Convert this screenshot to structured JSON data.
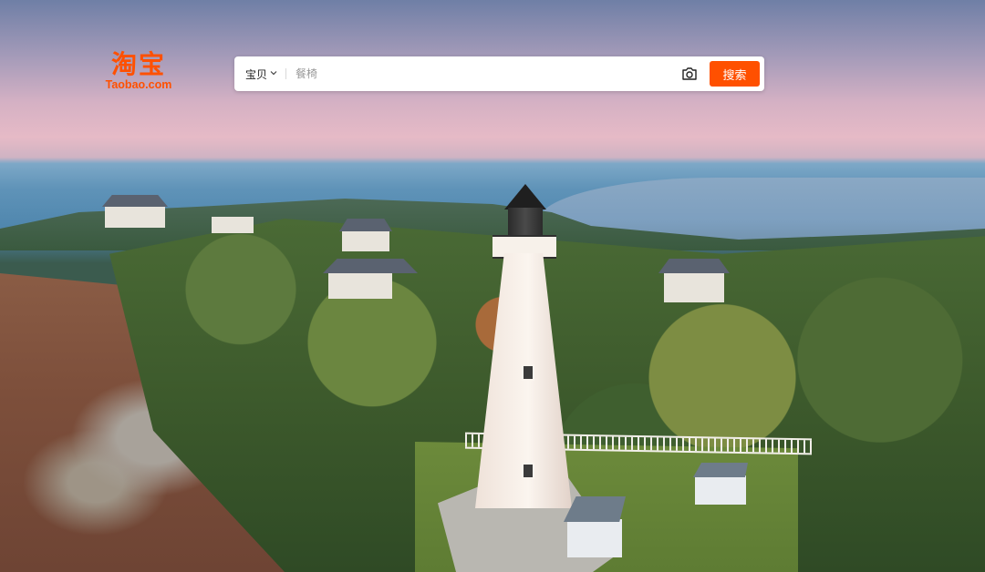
{
  "logo": {
    "text_cn": "淘宝",
    "text_en": "Taobao.com",
    "brand_color": "#ff5000"
  },
  "search": {
    "scope_label": "宝贝",
    "scope_icon": "chevron-down-icon",
    "placeholder": "餐椅",
    "camera_icon": "camera-icon",
    "button_label": "搜索",
    "button_color": "#ff5000"
  },
  "background": {
    "scene": "lighthouse-coast"
  }
}
